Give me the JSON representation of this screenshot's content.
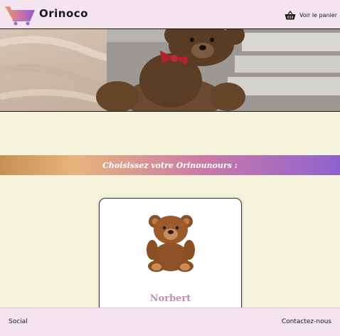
{
  "header": {
    "brand": "Orinoco",
    "cart_label": "Voir le panier",
    "logo_icon": "shopping-cart-icon",
    "cart_icon": "basket-icon"
  },
  "banner": {
    "image": "teddy-bear-photo"
  },
  "main": {
    "heading": "Choisissez votre Orinounours :"
  },
  "products": [
    {
      "name": "Norbert",
      "image": "teddy-bear-photo"
    }
  ],
  "footer": {
    "social": "Social",
    "contact": "Contactez-nous"
  },
  "colors": {
    "background": "#f5f2db",
    "header_bg": "#f3e4ee",
    "gradient_start": "#c98f52",
    "gradient_end": "#8f62cf",
    "product_name": "#c88bb5"
  }
}
